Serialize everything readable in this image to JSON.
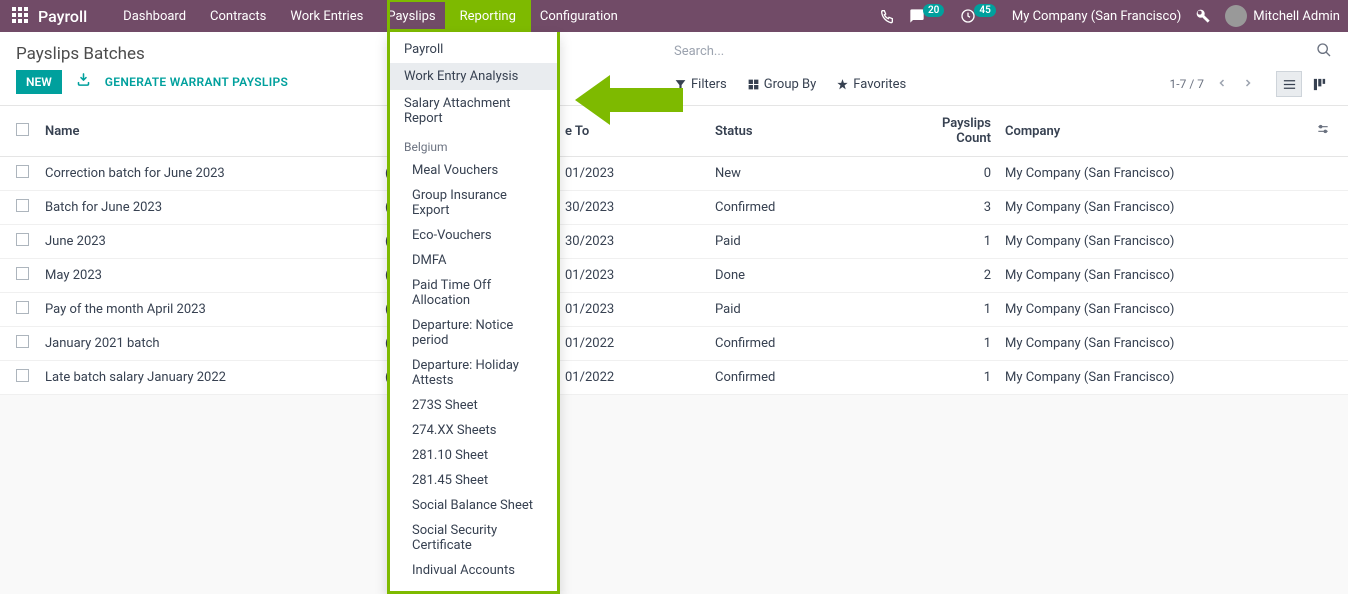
{
  "nav": {
    "brand": "Payroll",
    "items": [
      "Dashboard",
      "Contracts",
      "Work Entries",
      "Payslips",
      "Reporting",
      "Configuration"
    ],
    "active_index": 4,
    "msg_badge": "20",
    "activity_badge": "45",
    "company": "My Company (San Francisco)",
    "user": "Mitchell Admin"
  },
  "page": {
    "title": "Payslips Batches",
    "new_btn": "NEW",
    "generate_btn": "GENERATE WARRANT PAYSLIPS",
    "search_placeholder": "Search...",
    "filters_label": "Filters",
    "groupby_label": "Group By",
    "favorites_label": "Favorites",
    "pager": "1-7 / 7"
  },
  "dropdown": {
    "top": [
      "Payroll",
      "Work Entry Analysis",
      "Salary Attachment Report"
    ],
    "highlight_index": 1,
    "section_label": "Belgium",
    "sub": [
      "Meal Vouchers",
      "Group Insurance Export",
      "Eco-Vouchers",
      "DMFA",
      "Paid Time Off Allocation",
      "Departure: Notice period",
      "Departure: Holiday Attests",
      "273S Sheet",
      "274.XX Sheets",
      "281.10 Sheet",
      "281.45 Sheet",
      "Social Balance Sheet",
      "Social Security Certificate",
      "Indivual Accounts"
    ]
  },
  "table": {
    "headers": {
      "name": "Name",
      "date_to_partial": "e To",
      "status": "Status",
      "count": "Payslips Count",
      "company": "Company"
    },
    "rows": [
      {
        "name": "Correction batch for June 2023",
        "date_to": "01/2023",
        "status": "New",
        "count": 0,
        "company": "My Company (San Francisco)"
      },
      {
        "name": "Batch for June 2023",
        "date_to": "30/2023",
        "status": "Confirmed",
        "count": 3,
        "company": "My Company (San Francisco)"
      },
      {
        "name": "June 2023",
        "date_to": "30/2023",
        "status": "Paid",
        "count": 1,
        "company": "My Company (San Francisco)"
      },
      {
        "name": "May 2023",
        "date_to": "01/2023",
        "status": "Done",
        "count": 2,
        "company": "My Company (San Francisco)"
      },
      {
        "name": "Pay of the month April 2023",
        "date_to": "01/2023",
        "status": "Paid",
        "count": 1,
        "company": "My Company (San Francisco)"
      },
      {
        "name": "January 2021 batch",
        "date_to": "01/2022",
        "status": "Confirmed",
        "count": 1,
        "company": "My Company (San Francisco)"
      },
      {
        "name": "Late batch salary January 2022",
        "date_to": "01/2022",
        "status": "Confirmed",
        "count": 1,
        "company": "My Company (San Francisco)"
      }
    ]
  }
}
